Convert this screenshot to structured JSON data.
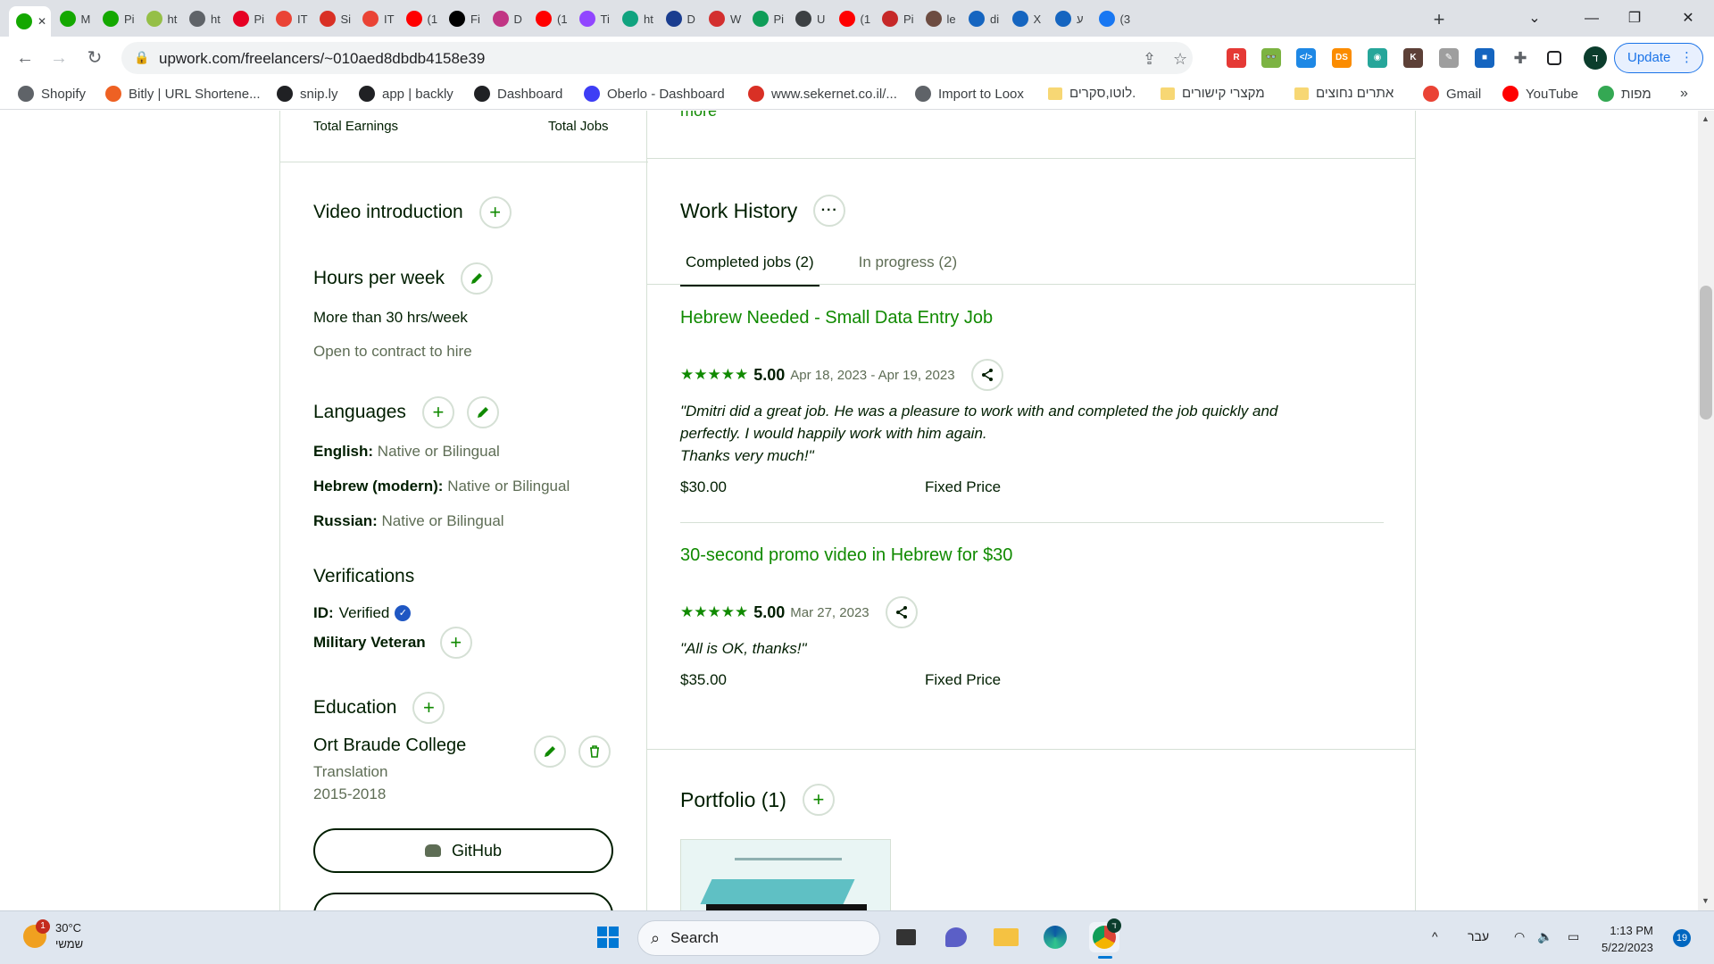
{
  "browser": {
    "tabs": [
      {
        "label": "",
        "icon": "upwork-icon",
        "color": "#14a800",
        "active": true
      },
      {
        "label": "M",
        "icon": "upwork-icon",
        "color": "#14a800"
      },
      {
        "label": "Pi",
        "icon": "upwork-icon",
        "color": "#14a800"
      },
      {
        "label": "ht",
        "icon": "shopify-icon",
        "color": "#95bf47"
      },
      {
        "label": "ht",
        "icon": "globe-icon",
        "color": "#5f6368"
      },
      {
        "label": "Pi",
        "icon": "pinterest-icon",
        "color": "#e60023"
      },
      {
        "label": "IT",
        "icon": "gmail-icon",
        "color": "#ea4335"
      },
      {
        "label": "Si",
        "icon": "wix-icon",
        "color": "#d93025"
      },
      {
        "label": "IT",
        "icon": "gmail-icon",
        "color": "#ea4335"
      },
      {
        "label": "(1",
        "icon": "youtube-icon",
        "color": "#ff0000"
      },
      {
        "label": "Fi",
        "icon": "tiktok-icon",
        "color": "#000000"
      },
      {
        "label": "D",
        "icon": "instagram-icon",
        "color": "#c13584"
      },
      {
        "label": "(1",
        "icon": "youtube-icon",
        "color": "#ff0000"
      },
      {
        "label": "Ti",
        "icon": "twitch-icon",
        "color": "#9146ff"
      },
      {
        "label": "ht",
        "icon": "chatgpt-icon",
        "color": "#10a37f"
      },
      {
        "label": "D",
        "icon": "cb-icon",
        "color": "#1a3d8f"
      },
      {
        "label": "W",
        "icon": "record-icon",
        "color": "#d32f2f"
      },
      {
        "label": "Pi",
        "icon": "p-icon",
        "color": "#0f9d58"
      },
      {
        "label": "U",
        "icon": "graduation-icon",
        "color": "#3c4043"
      },
      {
        "label": "(1",
        "icon": "youtube-icon",
        "color": "#ff0000"
      },
      {
        "label": "Pi",
        "icon": "tool-icon",
        "color": "#c62828"
      },
      {
        "label": "le",
        "icon": "avatar-icon",
        "color": "#6d4c41"
      },
      {
        "label": "di",
        "icon": "x-icon",
        "color": "#1565c0"
      },
      {
        "label": "X",
        "icon": "x-icon",
        "color": "#1565c0"
      },
      {
        "label": "ע",
        "icon": "x-icon",
        "color": "#1565c0"
      },
      {
        "label": "(3",
        "icon": "facebook-icon",
        "color": "#1877f2"
      }
    ],
    "new_tab_label": "+",
    "window_controls": [
      "⌄",
      "—",
      "❐",
      "✕"
    ],
    "url": "upwork.com/freelancers/~010aed8dbdb4158e39",
    "profile_initial": "ד",
    "update_label": "Update",
    "extensions": [
      {
        "icon": "r-extension-icon",
        "text": "R",
        "color": "#e53935"
      },
      {
        "icon": "glasses-extension-icon",
        "text": "👓",
        "color": "#7cb342"
      },
      {
        "icon": "code-extension-icon",
        "text": "</>",
        "color": "#1e88e5"
      },
      {
        "icon": "ds-extension-icon",
        "text": "DS",
        "color": "#fb8c00"
      },
      {
        "icon": "teal-extension-icon",
        "text": "◉",
        "color": "#26a69a"
      },
      {
        "icon": "k-extension-icon",
        "text": "K",
        "color": "#5d4037"
      },
      {
        "icon": "eraser-extension-icon",
        "text": "✎",
        "color": "#9e9e9e"
      },
      {
        "icon": "square-extension-icon",
        "text": "■",
        "color": "#1565c0"
      }
    ],
    "bookmarks": [
      {
        "label": "Shopify",
        "icon": "globe-icon",
        "color": "#5f6368"
      },
      {
        "label": "Bitly | URL Shortene...",
        "icon": "bitly-icon",
        "color": "#ee6123"
      },
      {
        "label": "snip.ly",
        "icon": "sniply-icon",
        "color": "#202124"
      },
      {
        "label": "app | backly",
        "icon": "backly-icon",
        "color": "#202124"
      },
      {
        "label": "Dashboard",
        "icon": "m-icon",
        "color": "#202124"
      },
      {
        "label": "Oberlo - Dashboard",
        "icon": "oberlo-icon",
        "color": "#3d3df5"
      },
      {
        "label": "www.sekernet.co.il/...",
        "icon": "sekernet-icon",
        "color": "#d93025"
      },
      {
        "label": "Import to Loox",
        "icon": "globe-icon",
        "color": "#5f6368"
      },
      {
        "label": "לוטו,סקרים.",
        "icon": "folder-icon",
        "color": "#f7d774"
      },
      {
        "label": "מקצרי קישורים",
        "icon": "folder-icon",
        "color": "#f7d774"
      },
      {
        "label": "אתרים נחוצים",
        "icon": "folder-icon",
        "color": "#f7d774"
      },
      {
        "label": "Gmail",
        "icon": "gmail-icon",
        "color": "#ea4335"
      },
      {
        "label": "YouTube",
        "icon": "youtube-icon",
        "color": "#ff0000"
      },
      {
        "label": "מפות",
        "icon": "maps-icon",
        "color": "#34a853"
      }
    ],
    "bookmarks_overflow": "»"
  },
  "left": {
    "stats": {
      "earnings_label": "Total Earnings",
      "jobs_label": "Total Jobs"
    },
    "video_intro": {
      "title": "Video introduction"
    },
    "hours": {
      "title": "Hours per week",
      "value": "More than 30 hrs/week",
      "contract": "Open to contract to hire"
    },
    "languages": {
      "title": "Languages",
      "items": [
        {
          "name": "English:",
          "level": "Native or Bilingual"
        },
        {
          "name": "Hebrew (modern):",
          "level": "Native or Bilingual"
        },
        {
          "name": "Russian:",
          "level": "Native or Bilingual"
        }
      ]
    },
    "verifications": {
      "title": "Verifications",
      "id_label": "ID:",
      "id_value": "Verified",
      "military": "Military Veteran"
    },
    "education": {
      "title": "Education",
      "school": "Ort Braude College",
      "field": "Translation",
      "years": "2015-2018"
    },
    "github_label": "GitHub"
  },
  "right": {
    "more_link": "more",
    "work_history": {
      "title": "Work History",
      "tabs": [
        "Completed jobs (2)",
        "In progress (2)"
      ],
      "jobs": [
        {
          "title": "Hebrew Needed - Small Data Entry Job",
          "stars": "★★★★★",
          "rating": "5.00",
          "dates": "Apr 18, 2023 - Apr 19, 2023",
          "feedback": "\"Dmitri did a great job. He was a pleasure to work with and completed the job quickly and perfectly. I would happily work with him again.",
          "feedback2": "Thanks very much!\"",
          "price": "$30.00",
          "type": "Fixed Price"
        },
        {
          "title": "30-second promo video in Hebrew for $30",
          "stars": "★★★★★",
          "rating": "5.00",
          "dates": "Mar 27, 2023",
          "feedback": "\"All is OK, thanks!\"",
          "price": "$35.00",
          "type": "Fixed Price"
        }
      ]
    },
    "portfolio": {
      "title": "Portfolio (1)"
    }
  },
  "taskbar": {
    "weather": {
      "temp": "30°C",
      "desc": "שמשי",
      "badge": "1"
    },
    "search_label": "Search",
    "tray": {
      "lang": "עבר",
      "chevron": "^"
    },
    "clock": {
      "time": "1:13 PM",
      "date": "5/22/2023"
    },
    "notifications": "19",
    "chrome_badge": "ד"
  }
}
